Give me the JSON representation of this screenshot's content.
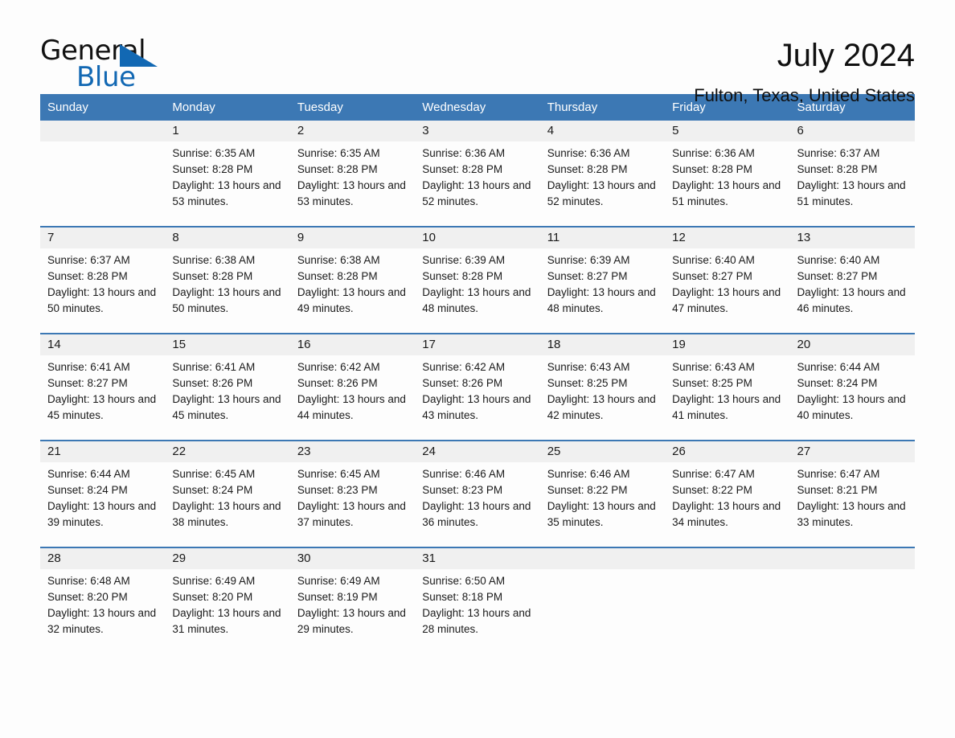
{
  "logo": {
    "word_one": "General",
    "word_two": "Blue",
    "triangle_color": "#1268b3"
  },
  "header": {
    "title": "July 2024",
    "subtitle": "Fulton, Texas, United States"
  },
  "theme": {
    "header_bg": "#3c78b4",
    "daynum_bg": "#f0f0f0",
    "page_bg": "#fdfdfd",
    "text": "#1a1a1a"
  },
  "calendar": {
    "weekday_headers": [
      "Sunday",
      "Monday",
      "Tuesday",
      "Wednesday",
      "Thursday",
      "Friday",
      "Saturday"
    ],
    "labels": {
      "sunrise": "Sunrise:",
      "sunset": "Sunset:",
      "daylight": "Daylight:"
    },
    "weeks": [
      [
        {
          "day": "",
          "empty": true
        },
        {
          "day": "1",
          "sunrise": "Sunrise: 6:35 AM",
          "sunset": "Sunset: 8:28 PM",
          "daylight": "Daylight: 13 hours and 53 minutes."
        },
        {
          "day": "2",
          "sunrise": "Sunrise: 6:35 AM",
          "sunset": "Sunset: 8:28 PM",
          "daylight": "Daylight: 13 hours and 53 minutes."
        },
        {
          "day": "3",
          "sunrise": "Sunrise: 6:36 AM",
          "sunset": "Sunset: 8:28 PM",
          "daylight": "Daylight: 13 hours and 52 minutes."
        },
        {
          "day": "4",
          "sunrise": "Sunrise: 6:36 AM",
          "sunset": "Sunset: 8:28 PM",
          "daylight": "Daylight: 13 hours and 52 minutes."
        },
        {
          "day": "5",
          "sunrise": "Sunrise: 6:36 AM",
          "sunset": "Sunset: 8:28 PM",
          "daylight": "Daylight: 13 hours and 51 minutes."
        },
        {
          "day": "6",
          "sunrise": "Sunrise: 6:37 AM",
          "sunset": "Sunset: 8:28 PM",
          "daylight": "Daylight: 13 hours and 51 minutes."
        }
      ],
      [
        {
          "day": "7",
          "sunrise": "Sunrise: 6:37 AM",
          "sunset": "Sunset: 8:28 PM",
          "daylight": "Daylight: 13 hours and 50 minutes."
        },
        {
          "day": "8",
          "sunrise": "Sunrise: 6:38 AM",
          "sunset": "Sunset: 8:28 PM",
          "daylight": "Daylight: 13 hours and 50 minutes."
        },
        {
          "day": "9",
          "sunrise": "Sunrise: 6:38 AM",
          "sunset": "Sunset: 8:28 PM",
          "daylight": "Daylight: 13 hours and 49 minutes."
        },
        {
          "day": "10",
          "sunrise": "Sunrise: 6:39 AM",
          "sunset": "Sunset: 8:28 PM",
          "daylight": "Daylight: 13 hours and 48 minutes."
        },
        {
          "day": "11",
          "sunrise": "Sunrise: 6:39 AM",
          "sunset": "Sunset: 8:27 PM",
          "daylight": "Daylight: 13 hours and 48 minutes."
        },
        {
          "day": "12",
          "sunrise": "Sunrise: 6:40 AM",
          "sunset": "Sunset: 8:27 PM",
          "daylight": "Daylight: 13 hours and 47 minutes."
        },
        {
          "day": "13",
          "sunrise": "Sunrise: 6:40 AM",
          "sunset": "Sunset: 8:27 PM",
          "daylight": "Daylight: 13 hours and 46 minutes."
        }
      ],
      [
        {
          "day": "14",
          "sunrise": "Sunrise: 6:41 AM",
          "sunset": "Sunset: 8:27 PM",
          "daylight": "Daylight: 13 hours and 45 minutes."
        },
        {
          "day": "15",
          "sunrise": "Sunrise: 6:41 AM",
          "sunset": "Sunset: 8:26 PM",
          "daylight": "Daylight: 13 hours and 45 minutes."
        },
        {
          "day": "16",
          "sunrise": "Sunrise: 6:42 AM",
          "sunset": "Sunset: 8:26 PM",
          "daylight": "Daylight: 13 hours and 44 minutes."
        },
        {
          "day": "17",
          "sunrise": "Sunrise: 6:42 AM",
          "sunset": "Sunset: 8:26 PM",
          "daylight": "Daylight: 13 hours and 43 minutes."
        },
        {
          "day": "18",
          "sunrise": "Sunrise: 6:43 AM",
          "sunset": "Sunset: 8:25 PM",
          "daylight": "Daylight: 13 hours and 42 minutes."
        },
        {
          "day": "19",
          "sunrise": "Sunrise: 6:43 AM",
          "sunset": "Sunset: 8:25 PM",
          "daylight": "Daylight: 13 hours and 41 minutes."
        },
        {
          "day": "20",
          "sunrise": "Sunrise: 6:44 AM",
          "sunset": "Sunset: 8:24 PM",
          "daylight": "Daylight: 13 hours and 40 minutes."
        }
      ],
      [
        {
          "day": "21",
          "sunrise": "Sunrise: 6:44 AM",
          "sunset": "Sunset: 8:24 PM",
          "daylight": "Daylight: 13 hours and 39 minutes."
        },
        {
          "day": "22",
          "sunrise": "Sunrise: 6:45 AM",
          "sunset": "Sunset: 8:24 PM",
          "daylight": "Daylight: 13 hours and 38 minutes."
        },
        {
          "day": "23",
          "sunrise": "Sunrise: 6:45 AM",
          "sunset": "Sunset: 8:23 PM",
          "daylight": "Daylight: 13 hours and 37 minutes."
        },
        {
          "day": "24",
          "sunrise": "Sunrise: 6:46 AM",
          "sunset": "Sunset: 8:23 PM",
          "daylight": "Daylight: 13 hours and 36 minutes."
        },
        {
          "day": "25",
          "sunrise": "Sunrise: 6:46 AM",
          "sunset": "Sunset: 8:22 PM",
          "daylight": "Daylight: 13 hours and 35 minutes."
        },
        {
          "day": "26",
          "sunrise": "Sunrise: 6:47 AM",
          "sunset": "Sunset: 8:22 PM",
          "daylight": "Daylight: 13 hours and 34 minutes."
        },
        {
          "day": "27",
          "sunrise": "Sunrise: 6:47 AM",
          "sunset": "Sunset: 8:21 PM",
          "daylight": "Daylight: 13 hours and 33 minutes."
        }
      ],
      [
        {
          "day": "28",
          "sunrise": "Sunrise: 6:48 AM",
          "sunset": "Sunset: 8:20 PM",
          "daylight": "Daylight: 13 hours and 32 minutes."
        },
        {
          "day": "29",
          "sunrise": "Sunrise: 6:49 AM",
          "sunset": "Sunset: 8:20 PM",
          "daylight": "Daylight: 13 hours and 31 minutes."
        },
        {
          "day": "30",
          "sunrise": "Sunrise: 6:49 AM",
          "sunset": "Sunset: 8:19 PM",
          "daylight": "Daylight: 13 hours and 29 minutes."
        },
        {
          "day": "31",
          "sunrise": "Sunrise: 6:50 AM",
          "sunset": "Sunset: 8:18 PM",
          "daylight": "Daylight: 13 hours and 28 minutes."
        },
        {
          "day": "",
          "empty": true
        },
        {
          "day": "",
          "empty": true
        },
        {
          "day": "",
          "empty": true
        }
      ]
    ]
  }
}
